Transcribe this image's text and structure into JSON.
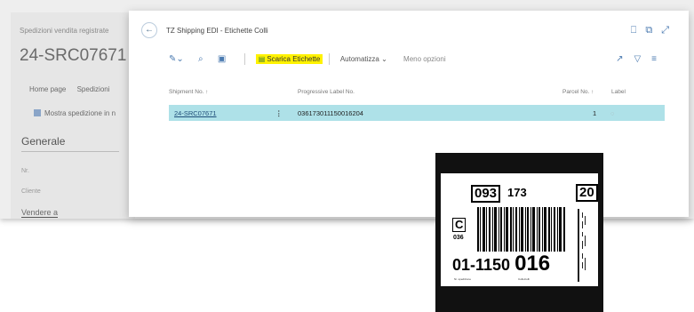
{
  "background_page": {
    "breadcrumb": "Spedizioni vendita registrate",
    "record_no": "24-SRC07671",
    "tabs": [
      "Home page",
      "Spedizioni"
    ],
    "action_label": "Mostra spedizione in n",
    "section_title": "Generale",
    "field_no": "Nr.",
    "field_cliente": "Cliente",
    "field_vendere": "Vendere a"
  },
  "dialog": {
    "title": "TZ Shipping EDI - Etichette Colli",
    "toolbar": {
      "scarica_label": "Scarica Etichette",
      "automatizza_label": "Automatizza",
      "meno_opzioni_label": "Meno opzioni"
    },
    "table": {
      "columns": [
        "Shipment No. ↑",
        "Progressive Label No.",
        "Parcel No. ↑",
        "Label"
      ],
      "rows": [
        {
          "shipment_no": "24-SRC07671",
          "progressive_label_no": "036173011150016204",
          "parcel_no": "1"
        }
      ]
    }
  },
  "shipping_label": {
    "code_box": "093",
    "code_after_box": "173",
    "count_box": "20",
    "letter_box": "C",
    "sub_code": "036",
    "route_prefix": "01-1150",
    "route_main": "016",
    "footer_left": "Nr. spedizione",
    "footer_right": "Collo/colli"
  },
  "icons": {
    "back": "back-arrow-icon",
    "bookmark": "bookmark-icon",
    "open_new": "open-in-new-window-icon",
    "expand": "expand-icon",
    "edit_list": "edit-list-icon",
    "search": "search-icon",
    "excel": "excel-icon",
    "scarica": "download-labels-icon",
    "share": "share-icon",
    "filter": "filter-icon",
    "list_menu": "list-menu-icon",
    "label": "label-icon"
  }
}
